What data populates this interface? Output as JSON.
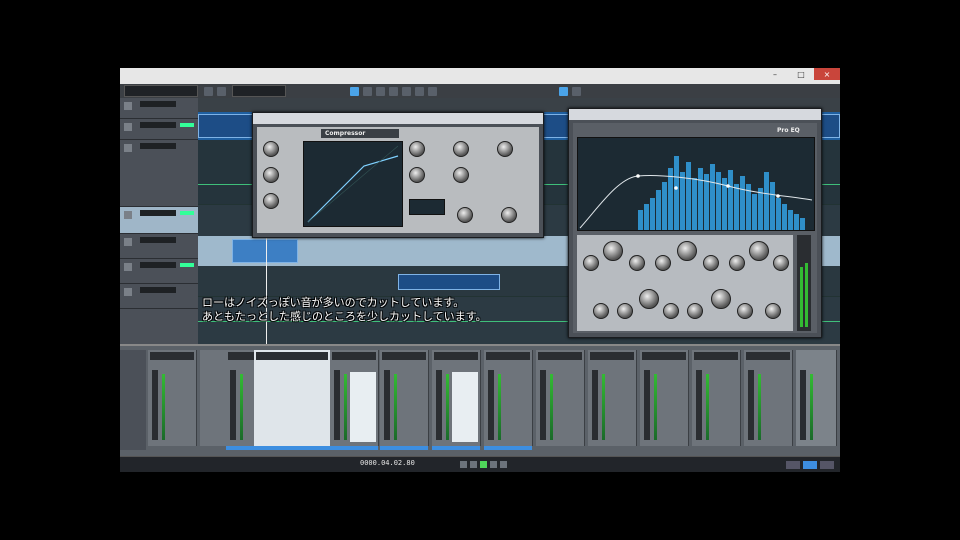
{
  "subtitles": {
    "line1": "ローはノイズっぽい音が多いのでカットしています。",
    "line2": "あともたっとした感じのところを少しカットしています。"
  },
  "compressor": {
    "header": "Compressor"
  },
  "eq": {
    "header": "Pro EQ"
  },
  "transport": {
    "time": "0000.04.02.80"
  },
  "colors": {
    "accent": "#3d8ee0",
    "clip": "#3d7fc4",
    "play": "#4fd55a",
    "spectrum": "#2f8fc9"
  }
}
